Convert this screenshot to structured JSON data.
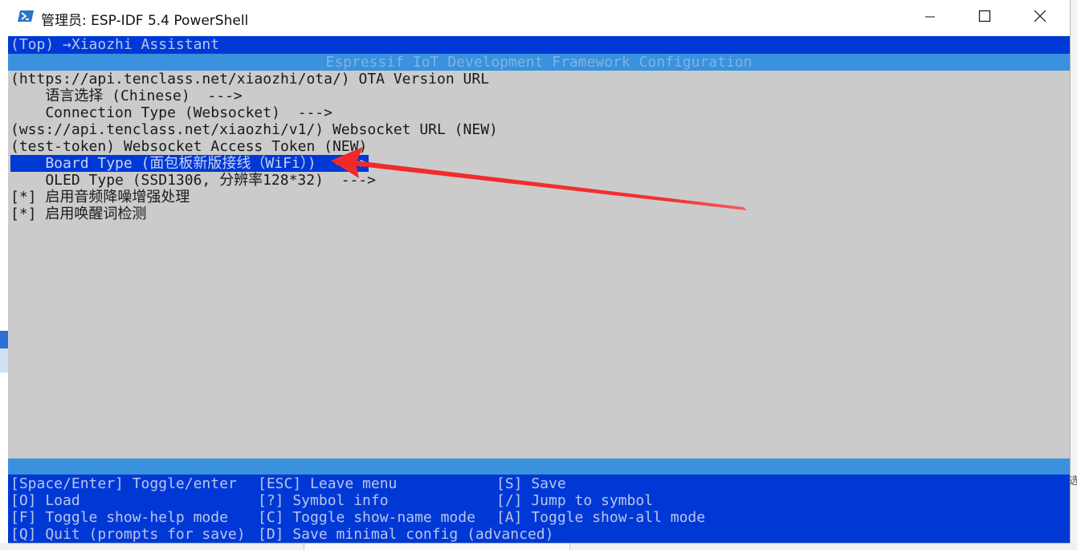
{
  "window": {
    "title": "管理员: ESP-IDF 5.4 PowerShell",
    "icon": "powershell-icon",
    "controls": [
      "minimize-icon",
      "maximize-icon",
      "close-icon"
    ]
  },
  "menuconfig": {
    "breadcrumb": "(Top) →Xiaozhi Assistant",
    "header_title": "Espressif IoT Development Framework Configuration",
    "items": [
      {
        "text": "(https://api.tenclass.net/xiaozhi/ota/) OTA Version URL",
        "selected": false
      },
      {
        "text": "    语言选择 (Chinese)  --->",
        "selected": false
      },
      {
        "text": "    Connection Type (Websocket)  --->",
        "selected": false
      },
      {
        "text": "(wss://api.tenclass.net/xiaozhi/v1/) Websocket URL (NEW)",
        "selected": false
      },
      {
        "text": "(test-token) Websocket Access Token (NEW)",
        "selected": false
      },
      {
        "text": "    Board Type (面包板新版接线（WiFi）)  --->",
        "selected": true
      },
      {
        "text": "    OLED Type (SSD1306, 分辨率128*32)  --->",
        "selected": false
      },
      {
        "text": "[*] 启用音频降噪增强处理",
        "selected": false
      },
      {
        "text": "[*] 启用唤醒词检测",
        "selected": false
      }
    ],
    "help": {
      "col1": [
        "[Space/Enter] Toggle/enter",
        "[O] Load",
        "[F] Toggle show-help mode",
        "[Q] Quit (prompts for save)"
      ],
      "col2": [
        "[ESC] Leave menu",
        "[?] Symbol info",
        "[C] Toggle show-name mode",
        "[D] Save minimal config (advanced)"
      ],
      "col3": [
        "[S] Save",
        "[/] Jump to symbol",
        "[A] Toggle show-all mode",
        ""
      ]
    }
  },
  "annotation": {
    "type": "arrow",
    "color": "#f02a2a",
    "points_to": "Board Type"
  },
  "colors": {
    "console_bg": "#cbcbcb",
    "selection_bg": "#0038d6",
    "header_bg": "#3a91dd"
  },
  "background": {
    "right_edge_glyph": "选"
  }
}
